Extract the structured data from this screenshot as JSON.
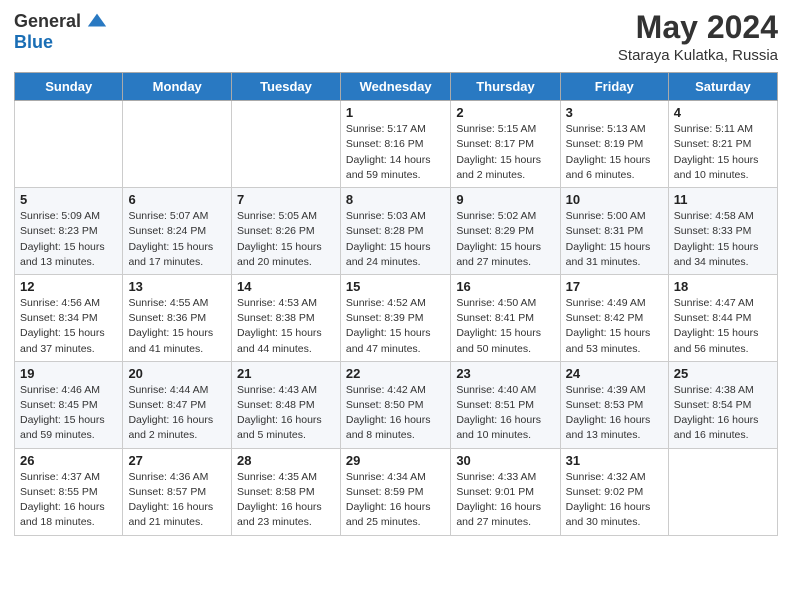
{
  "header": {
    "logo_general": "General",
    "logo_blue": "Blue",
    "title": "May 2024",
    "subtitle": "Staraya Kulatka, Russia"
  },
  "days_of_week": [
    "Sunday",
    "Monday",
    "Tuesday",
    "Wednesday",
    "Thursday",
    "Friday",
    "Saturday"
  ],
  "weeks": [
    [
      {
        "num": "",
        "detail": ""
      },
      {
        "num": "",
        "detail": ""
      },
      {
        "num": "",
        "detail": ""
      },
      {
        "num": "1",
        "detail": "Sunrise: 5:17 AM\nSunset: 8:16 PM\nDaylight: 14 hours\nand 59 minutes."
      },
      {
        "num": "2",
        "detail": "Sunrise: 5:15 AM\nSunset: 8:17 PM\nDaylight: 15 hours\nand 2 minutes."
      },
      {
        "num": "3",
        "detail": "Sunrise: 5:13 AM\nSunset: 8:19 PM\nDaylight: 15 hours\nand 6 minutes."
      },
      {
        "num": "4",
        "detail": "Sunrise: 5:11 AM\nSunset: 8:21 PM\nDaylight: 15 hours\nand 10 minutes."
      }
    ],
    [
      {
        "num": "5",
        "detail": "Sunrise: 5:09 AM\nSunset: 8:23 PM\nDaylight: 15 hours\nand 13 minutes."
      },
      {
        "num": "6",
        "detail": "Sunrise: 5:07 AM\nSunset: 8:24 PM\nDaylight: 15 hours\nand 17 minutes."
      },
      {
        "num": "7",
        "detail": "Sunrise: 5:05 AM\nSunset: 8:26 PM\nDaylight: 15 hours\nand 20 minutes."
      },
      {
        "num": "8",
        "detail": "Sunrise: 5:03 AM\nSunset: 8:28 PM\nDaylight: 15 hours\nand 24 minutes."
      },
      {
        "num": "9",
        "detail": "Sunrise: 5:02 AM\nSunset: 8:29 PM\nDaylight: 15 hours\nand 27 minutes."
      },
      {
        "num": "10",
        "detail": "Sunrise: 5:00 AM\nSunset: 8:31 PM\nDaylight: 15 hours\nand 31 minutes."
      },
      {
        "num": "11",
        "detail": "Sunrise: 4:58 AM\nSunset: 8:33 PM\nDaylight: 15 hours\nand 34 minutes."
      }
    ],
    [
      {
        "num": "12",
        "detail": "Sunrise: 4:56 AM\nSunset: 8:34 PM\nDaylight: 15 hours\nand 37 minutes."
      },
      {
        "num": "13",
        "detail": "Sunrise: 4:55 AM\nSunset: 8:36 PM\nDaylight: 15 hours\nand 41 minutes."
      },
      {
        "num": "14",
        "detail": "Sunrise: 4:53 AM\nSunset: 8:38 PM\nDaylight: 15 hours\nand 44 minutes."
      },
      {
        "num": "15",
        "detail": "Sunrise: 4:52 AM\nSunset: 8:39 PM\nDaylight: 15 hours\nand 47 minutes."
      },
      {
        "num": "16",
        "detail": "Sunrise: 4:50 AM\nSunset: 8:41 PM\nDaylight: 15 hours\nand 50 minutes."
      },
      {
        "num": "17",
        "detail": "Sunrise: 4:49 AM\nSunset: 8:42 PM\nDaylight: 15 hours\nand 53 minutes."
      },
      {
        "num": "18",
        "detail": "Sunrise: 4:47 AM\nSunset: 8:44 PM\nDaylight: 15 hours\nand 56 minutes."
      }
    ],
    [
      {
        "num": "19",
        "detail": "Sunrise: 4:46 AM\nSunset: 8:45 PM\nDaylight: 15 hours\nand 59 minutes."
      },
      {
        "num": "20",
        "detail": "Sunrise: 4:44 AM\nSunset: 8:47 PM\nDaylight: 16 hours\nand 2 minutes."
      },
      {
        "num": "21",
        "detail": "Sunrise: 4:43 AM\nSunset: 8:48 PM\nDaylight: 16 hours\nand 5 minutes."
      },
      {
        "num": "22",
        "detail": "Sunrise: 4:42 AM\nSunset: 8:50 PM\nDaylight: 16 hours\nand 8 minutes."
      },
      {
        "num": "23",
        "detail": "Sunrise: 4:40 AM\nSunset: 8:51 PM\nDaylight: 16 hours\nand 10 minutes."
      },
      {
        "num": "24",
        "detail": "Sunrise: 4:39 AM\nSunset: 8:53 PM\nDaylight: 16 hours\nand 13 minutes."
      },
      {
        "num": "25",
        "detail": "Sunrise: 4:38 AM\nSunset: 8:54 PM\nDaylight: 16 hours\nand 16 minutes."
      }
    ],
    [
      {
        "num": "26",
        "detail": "Sunrise: 4:37 AM\nSunset: 8:55 PM\nDaylight: 16 hours\nand 18 minutes."
      },
      {
        "num": "27",
        "detail": "Sunrise: 4:36 AM\nSunset: 8:57 PM\nDaylight: 16 hours\nand 21 minutes."
      },
      {
        "num": "28",
        "detail": "Sunrise: 4:35 AM\nSunset: 8:58 PM\nDaylight: 16 hours\nand 23 minutes."
      },
      {
        "num": "29",
        "detail": "Sunrise: 4:34 AM\nSunset: 8:59 PM\nDaylight: 16 hours\nand 25 minutes."
      },
      {
        "num": "30",
        "detail": "Sunrise: 4:33 AM\nSunset: 9:01 PM\nDaylight: 16 hours\nand 27 minutes."
      },
      {
        "num": "31",
        "detail": "Sunrise: 4:32 AM\nSunset: 9:02 PM\nDaylight: 16 hours\nand 30 minutes."
      },
      {
        "num": "",
        "detail": ""
      }
    ]
  ]
}
